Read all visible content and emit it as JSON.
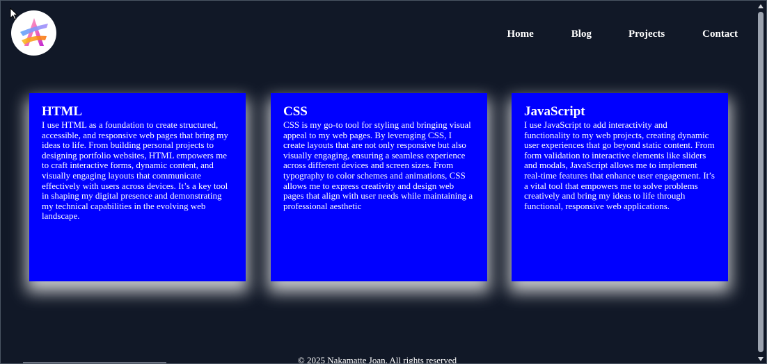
{
  "nav": {
    "items": [
      {
        "label": "Home"
      },
      {
        "label": "Blog"
      },
      {
        "label": "Projects"
      },
      {
        "label": "Contact"
      }
    ]
  },
  "cards": [
    {
      "title": "HTML",
      "text": "I use HTML as a foundation to create structured, accessible, and responsive web pages that bring my ideas to life. From building personal projects to designing portfolio websites, HTML empowers me to craft interactive forms, dynamic content, and visually engaging layouts that communicate effectively with users across devices. It’s a key tool in shaping my digital presence and demonstrating my technical capabilities in the evolving web landscape."
    },
    {
      "title": "CSS",
      "text": "CSS is my go-to tool for styling and bringing visual appeal to my web pages. By leveraging CSS, I create layouts that are not only responsive but also visually engaging, ensuring a seamless experience across different devices and screen sizes. From typography to color schemes and animations, CSS allows me to express creativity and design web pages that align with user needs while maintaining a professional aesthetic"
    },
    {
      "title": "JavaScript",
      "text": "I use JavaScript to add interactivity and functionality to my web projects, creating dynamic user experiences that go beyond static content. From form validation to interactive elements like sliders and modals, JavaScript allows me to implement real-time features that enhance user engagement. It’s a vital tool that empowers me to solve problems creatively and bring my ideas to life through functional, responsive web applications."
    }
  ],
  "footer": {
    "text": "© 2025 Nakamatte Joan. All rights reserved"
  },
  "colors": {
    "background": "#111827",
    "card": "#0000ff",
    "text": "#ffffff"
  },
  "icons": {
    "logo": "letter-a-logo"
  }
}
